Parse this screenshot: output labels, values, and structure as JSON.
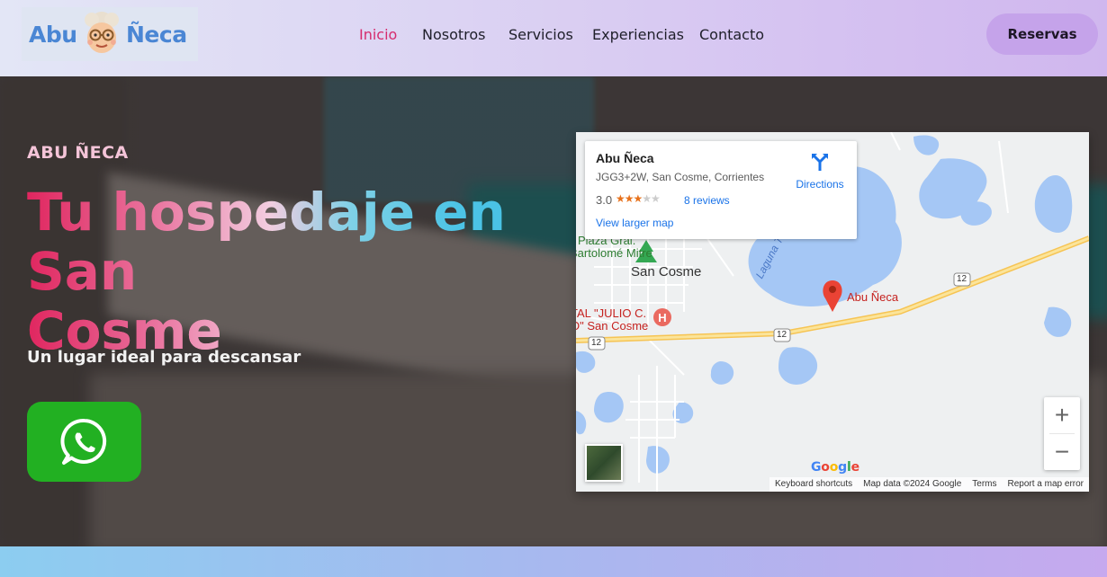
{
  "header": {
    "logo": {
      "left": "Abu",
      "right": "Ñeca"
    },
    "nav": [
      {
        "label": "Inicio",
        "active": true
      },
      {
        "label": "Nosotros",
        "active": false
      },
      {
        "label": "Servicios",
        "active": false
      },
      {
        "label": "Experiencias",
        "active": false
      },
      {
        "label": "Contacto",
        "active": false
      }
    ],
    "cta": "Reservas"
  },
  "hero": {
    "eyebrow": "ABU ÑECA",
    "title_line1": "Tu hospedaje en San",
    "title_line2": "Cosme",
    "tagline": "Un lugar ideal para descansar",
    "whatsapp_icon": "whatsapp-icon"
  },
  "map": {
    "card": {
      "name": "Abu Ñeca",
      "address": "JGG3+2W, San Cosme, Corrientes",
      "rating": "3.0",
      "stars_filled": 3,
      "stars_total": 5,
      "reviews": "8 reviews",
      "larger_map": "View larger map",
      "directions": "Directions"
    },
    "labels": {
      "town": "San Cosme",
      "place": "Abu Ñeca",
      "plaza1": "Plaza Gral.",
      "plaza2": "Bartolomé Mitre",
      "hospital1": "TAL \"JULIO C.",
      "hospital2": "O\" San Cosme",
      "lake": "Laguna Tu",
      "route": "12"
    },
    "zoom_in": "+",
    "zoom_out": "−",
    "google": "Google",
    "footer": [
      "Keyboard shortcuts",
      "Map data ©2024 Google",
      "Terms",
      "Report a map error"
    ]
  },
  "colors": {
    "accent_pink": "#d62c6e",
    "whatsapp_green": "#22b022",
    "reserve_bg": "#c5a3ea",
    "map_water": "#a5c7f5",
    "map_road": "#f9d56b"
  }
}
